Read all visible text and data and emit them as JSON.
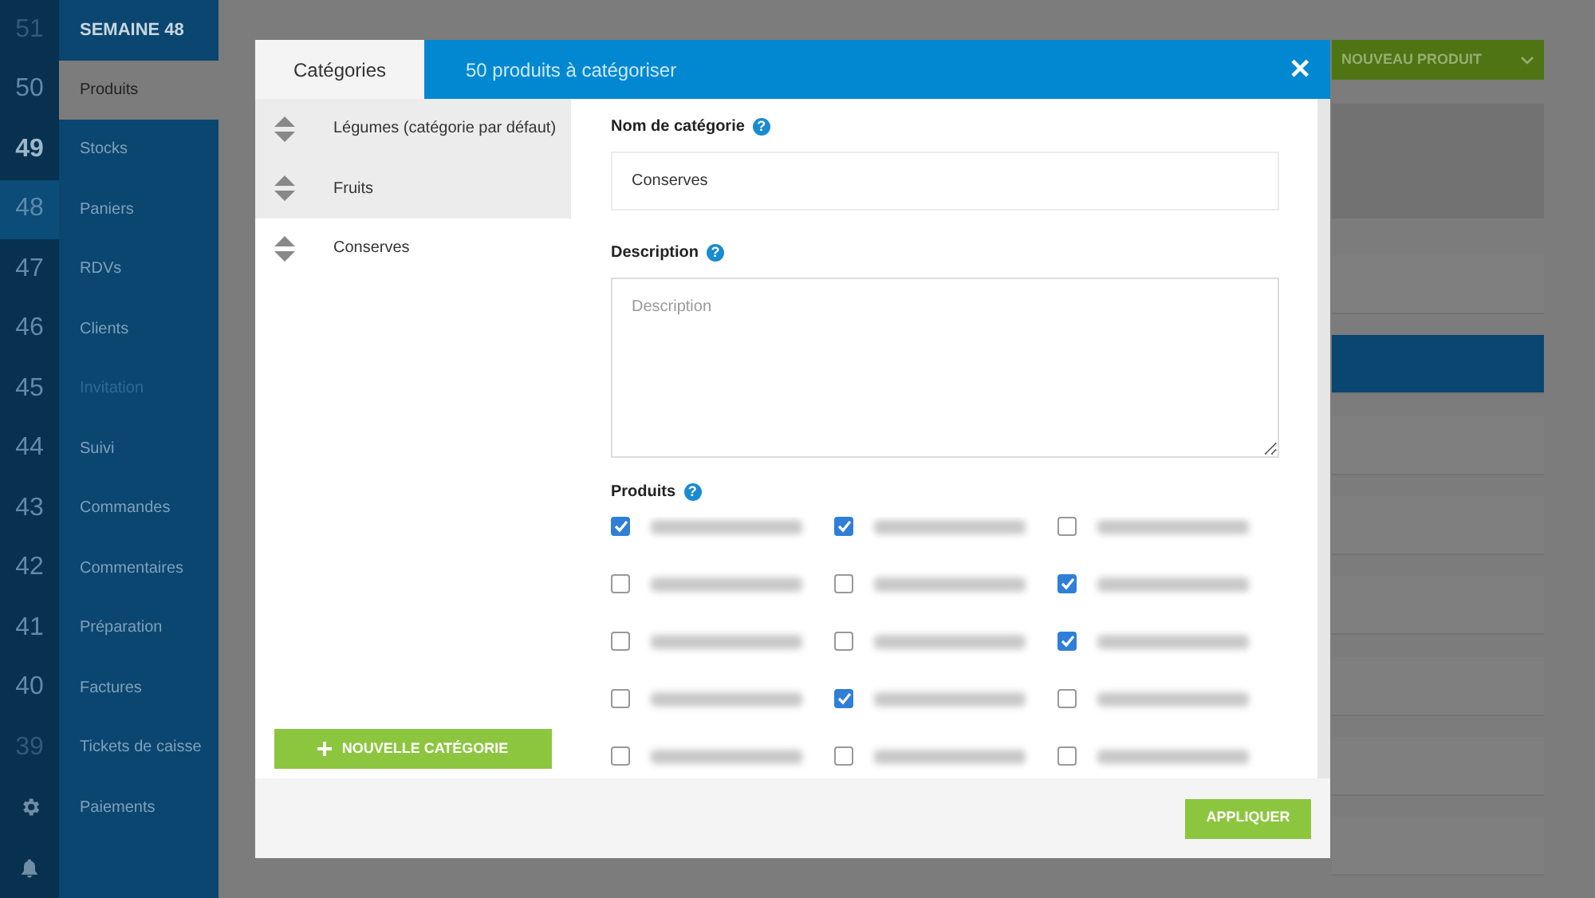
{
  "rail": [
    {
      "kind": "number",
      "label": "51",
      "disabled": true,
      "current": false,
      "selected": false
    },
    {
      "kind": "number",
      "label": "50",
      "disabled": false,
      "current": false,
      "selected": false
    },
    {
      "kind": "number",
      "label": "49",
      "disabled": false,
      "current": true,
      "selected": false
    },
    {
      "kind": "number",
      "label": "48",
      "disabled": false,
      "current": false,
      "selected": true
    },
    {
      "kind": "number",
      "label": "47",
      "disabled": false,
      "current": false,
      "selected": false
    },
    {
      "kind": "number",
      "label": "46",
      "disabled": false,
      "current": false,
      "selected": false
    },
    {
      "kind": "number",
      "label": "45",
      "disabled": false,
      "current": false,
      "selected": false
    },
    {
      "kind": "number",
      "label": "44",
      "disabled": false,
      "current": false,
      "selected": false
    },
    {
      "kind": "number",
      "label": "43",
      "disabled": false,
      "current": false,
      "selected": false
    },
    {
      "kind": "number",
      "label": "42",
      "disabled": false,
      "current": false,
      "selected": false
    },
    {
      "kind": "number",
      "label": "41",
      "disabled": false,
      "current": false,
      "selected": false
    },
    {
      "kind": "number",
      "label": "40",
      "disabled": false,
      "current": false,
      "selected": false
    },
    {
      "kind": "number",
      "label": "39",
      "disabled": true,
      "current": false,
      "selected": false
    },
    {
      "kind": "gear",
      "selected": false
    },
    {
      "kind": "bell",
      "selected": false
    }
  ],
  "sidebar": {
    "title": "SEMAINE 48",
    "items": [
      {
        "label": "Produits",
        "selected": true,
        "disabled": false
      },
      {
        "label": "Stocks",
        "selected": false,
        "disabled": false
      },
      {
        "label": "Paniers",
        "selected": false,
        "disabled": false
      },
      {
        "label": "RDVs",
        "selected": false,
        "disabled": false
      },
      {
        "label": "Clients",
        "selected": false,
        "disabled": false
      },
      {
        "label": "Invitation",
        "selected": false,
        "disabled": true
      },
      {
        "label": "Suivi",
        "selected": false,
        "disabled": false
      },
      {
        "label": "Commandes",
        "selected": false,
        "disabled": false
      },
      {
        "label": "Commentaires",
        "selected": false,
        "disabled": false
      },
      {
        "label": "Préparation",
        "selected": false,
        "disabled": false
      },
      {
        "label": "Factures",
        "selected": false,
        "disabled": false
      },
      {
        "label": "Tickets de caisse",
        "selected": false,
        "disabled": false
      },
      {
        "label": "Paiements",
        "selected": false,
        "disabled": false
      }
    ]
  },
  "background": {
    "new_product_button": "NOUVEAU PRODUIT",
    "cards": [
      {
        "selected": false
      },
      {
        "selected": true
      },
      {
        "selected": false
      },
      {
        "selected": false
      },
      {
        "selected": false
      },
      {
        "selected": false
      },
      {
        "selected": false
      },
      {
        "selected": false
      }
    ]
  },
  "modal": {
    "tabs": [
      {
        "label": "Catégories",
        "selected": true
      },
      {
        "label": "50 produits à catégoriser",
        "selected": false
      }
    ],
    "close": "✕",
    "categories": [
      {
        "label": "Légumes (catégorie par défaut)",
        "selected": false
      },
      {
        "label": "Fruits",
        "selected": false
      },
      {
        "label": "Conserves",
        "selected": true
      }
    ],
    "new_category_button": "NOUVELLE CATÉGORIE",
    "name_label": "Nom de catégorie",
    "name_help": "?",
    "name_value": "Conserves",
    "description_label": "Description",
    "description_help": "?",
    "description_placeholder": "Description",
    "products_label": "Produits",
    "products_help": "?",
    "products": [
      {
        "checked": true
      },
      {
        "checked": true
      },
      {
        "checked": false
      },
      {
        "checked": false
      },
      {
        "checked": false
      },
      {
        "checked": true
      },
      {
        "checked": false
      },
      {
        "checked": false
      },
      {
        "checked": true
      },
      {
        "checked": false
      },
      {
        "checked": true
      },
      {
        "checked": false
      },
      {
        "checked": false
      },
      {
        "checked": false
      },
      {
        "checked": false
      }
    ],
    "apply_button": "APPLIQUER"
  }
}
